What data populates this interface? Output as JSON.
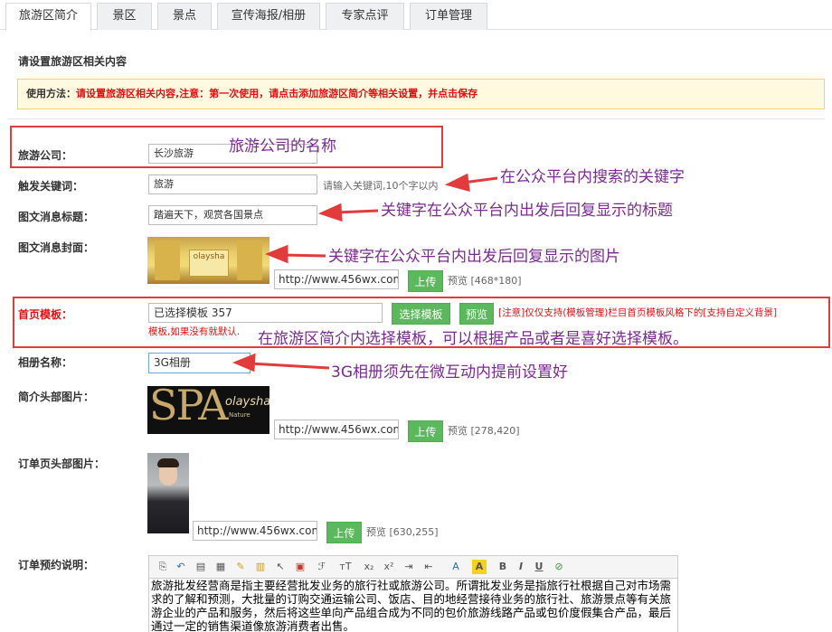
{
  "tabs": [
    {
      "label": "旅游区简介",
      "active": true
    },
    {
      "label": "景区",
      "active": false
    },
    {
      "label": "景点",
      "active": false
    },
    {
      "label": "宣传海报/相册",
      "active": false
    },
    {
      "label": "专家点评",
      "active": false
    },
    {
      "label": "订单管理",
      "active": false
    }
  ],
  "section_title": "请设置旅游区相关内容",
  "notice": {
    "prefix": "使用方法：",
    "message": "请设置旅游区相关内容,注意：第一次使用，请点击添加旅游区简介等相关设置，并点击保存"
  },
  "form": {
    "company_label": "旅游公司：",
    "company_value": "长沙旅游",
    "keyword_label": "触发关键词：",
    "keyword_value": "旅游",
    "keyword_hint": "请输入关键词,10个字以内",
    "news_title_label": "图文消息标题：",
    "news_title_value": "踏遍天下，观赏各国景点",
    "news_cover_label": "图文消息封面：",
    "cover_url": "http://www.456wx.com,",
    "cover_size": "预览 [468*180]",
    "template_label": "首页模板：",
    "template_value": "已选择模板 357",
    "template_select_btn": "选择模板",
    "template_preview_btn": "预览",
    "template_note_line1": "[注意]仅仅支持(模板管理)栏目首页模板风格下的[支持自定义背景]",
    "template_note_line2": "模板,如果没有就默认.",
    "album_label": "相册名称：",
    "album_value": "3G相册",
    "intro_header_label": "简介头部图片：",
    "intro_header_url": "http://www.456wx.com,",
    "intro_header_size": "预览 [278,420]",
    "order_header_label": "订单页头部图片：",
    "order_header_url": "http://www.456wx.com,",
    "order_header_size": "预览 [630,255]",
    "order_desc_label": "订单预约说明：",
    "upload_btn": "上传",
    "order_desc_text": "旅游批发经营商是指主要经营批发业务的旅行社或旅游公司。所谓批发业务是指旅行社根据自己对市场需求的了解和预测，大批量的订购交通运输公司、饭店、目的地经营接待业务的旅行社、旅游景点等有关旅游企业的产品和服务，然后将这些单向产品组合成为不同的包价旅游线路产品或包价度假集合产品，最后通过一定的销售渠道像旅游消费者出售。"
  },
  "cover_image_text": "olaysha",
  "spa_image_text": {
    "big": "SPA",
    "brand": "olaysha",
    "sub": "Nature"
  },
  "annotations": {
    "company": "旅游公司的名称",
    "keyword": "在公众平台内搜索的关键字",
    "title": "关键字在公众平台内出发后回复显示的标题",
    "cover": "关键字在公众平台内出发后回复显示的图片",
    "template": "在旅游区简介内选择模板，可以根据产品或者是喜好选择模板。",
    "album": "3G相册须先在微互动内提前设置好"
  },
  "toolbar_icons": [
    "source-icon",
    "undo-icon",
    "copy-icon",
    "paste-icon",
    "brush-icon",
    "paste-text-icon",
    "pointer-icon",
    "table-icon",
    "font-family-icon",
    "font-size-icon",
    "subscript-icon",
    "superscript-icon",
    "indent-icon",
    "outdent-icon",
    "font-color-icon",
    "highlight-icon",
    "bold-icon",
    "italic-icon",
    "underline-icon",
    "clear-format-icon"
  ],
  "toolbar_glyphs": [
    "⎘",
    "↶",
    "▤",
    "▦",
    "✎",
    "▥",
    "↖",
    "▣",
    "ℱ",
    "ᴛT",
    "x₂",
    "x²",
    "⇥",
    "⇤",
    "A",
    "A",
    "B",
    "I",
    "U",
    "⊘"
  ],
  "colors": {
    "accent_green": "#5cb85c",
    "warn_red": "#e01010",
    "annot_red": "#e23b3b",
    "annot_purple": "#7b2a92"
  }
}
